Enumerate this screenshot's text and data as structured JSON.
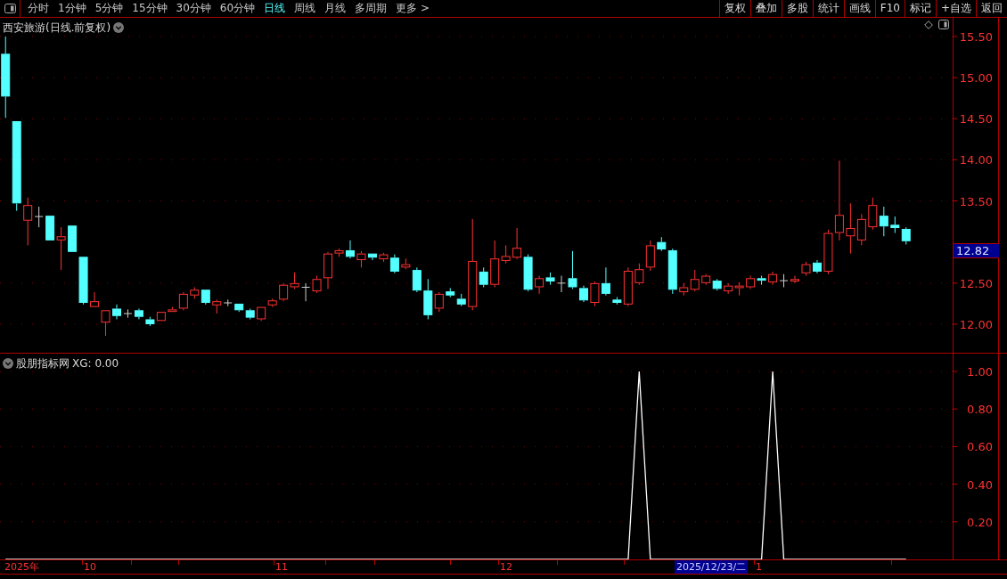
{
  "toolbar": {
    "periods": [
      {
        "label": "分时",
        "selected": false
      },
      {
        "label": "1分钟",
        "selected": false
      },
      {
        "label": "5分钟",
        "selected": false
      },
      {
        "label": "15分钟",
        "selected": false
      },
      {
        "label": "30分钟",
        "selected": false
      },
      {
        "label": "60分钟",
        "selected": false
      },
      {
        "label": "日线",
        "selected": true
      },
      {
        "label": "周线",
        "selected": false
      },
      {
        "label": "月线",
        "selected": false
      },
      {
        "label": "多周期",
        "selected": false
      },
      {
        "label": "更多 >",
        "selected": false
      }
    ],
    "buttons": [
      "复权",
      "叠加",
      "多股",
      "统计",
      "画线",
      "F10",
      "标记",
      "+自选",
      "返回"
    ]
  },
  "price_panel": {
    "title": "西安旅游(日线.前复权)",
    "current_price": "12.82",
    "chart_data": {
      "type": "candlestick",
      "grid": true,
      "ylim": [
        12.0,
        15.5
      ],
      "categories": [
        null,
        null,
        null,
        null,
        null,
        null,
        null,
        null,
        null,
        null,
        null,
        null,
        null,
        null,
        null,
        null,
        null,
        null,
        null,
        null,
        null,
        null,
        null,
        null,
        null,
        null,
        null,
        null,
        null,
        null,
        null,
        null,
        null,
        null,
        null,
        null,
        null,
        null,
        null,
        null,
        null,
        null,
        null,
        null,
        null,
        null,
        null,
        null,
        null,
        null,
        null,
        null,
        null,
        null,
        null,
        null,
        null,
        null,
        null,
        null,
        null,
        null,
        null,
        null,
        null,
        null,
        null,
        null,
        null,
        null,
        null,
        null,
        null,
        null,
        null,
        null,
        null,
        null,
        null,
        null,
        null,
        null
      ],
      "yticks": [
        {
          "value": 15.5,
          "label": "15.50"
        },
        {
          "value": 15.0,
          "label": "15.00"
        },
        {
          "value": 14.5,
          "label": "14.50"
        },
        {
          "value": 14.0,
          "label": "14.00"
        },
        {
          "value": 13.5,
          "label": "13.50"
        },
        {
          "value": 12.5,
          "label": "12.50"
        },
        {
          "value": 12.0,
          "label": "12.00"
        }
      ],
      "ohlc": [
        [
          15.29,
          15.5,
          14.51,
          14.77
        ],
        [
          14.47,
          14.47,
          13.38,
          13.47
        ],
        [
          13.26,
          13.54,
          12.96,
          13.45
        ],
        [
          13.31,
          13.43,
          13.18,
          13.31
        ],
        [
          13.32,
          13.32,
          13.02,
          13.02
        ],
        [
          13.02,
          13.18,
          12.66,
          13.07
        ],
        [
          13.2,
          13.2,
          12.88,
          12.88
        ],
        [
          12.82,
          12.82,
          12.24,
          12.26
        ],
        [
          12.21,
          12.39,
          12.21,
          12.28
        ],
        [
          12.02,
          12.17,
          11.86,
          12.17
        ],
        [
          12.19,
          12.24,
          12.06,
          12.1
        ],
        [
          12.13,
          12.18,
          12.08,
          12.13
        ],
        [
          12.17,
          12.19,
          12.06,
          12.09
        ],
        [
          12.06,
          12.09,
          11.98,
          12.0
        ],
        [
          12.04,
          12.16,
          12.03,
          12.15
        ],
        [
          12.15,
          12.21,
          12.14,
          12.18
        ],
        [
          12.19,
          12.39,
          12.17,
          12.37
        ],
        [
          12.35,
          12.45,
          12.31,
          12.42
        ],
        [
          12.42,
          12.42,
          12.24,
          12.26
        ],
        [
          12.23,
          12.3,
          12.13,
          12.28
        ],
        [
          12.26,
          12.3,
          12.22,
          12.26
        ],
        [
          12.25,
          12.26,
          12.15,
          12.17
        ],
        [
          12.17,
          12.19,
          12.06,
          12.08
        ],
        [
          12.06,
          12.22,
          12.04,
          12.21
        ],
        [
          12.23,
          12.31,
          12.21,
          12.29
        ],
        [
          12.3,
          12.5,
          12.28,
          12.48
        ],
        [
          12.45,
          12.63,
          12.43,
          12.5
        ],
        [
          12.45,
          12.5,
          12.28,
          12.45
        ],
        [
          12.4,
          12.59,
          12.38,
          12.55
        ],
        [
          12.56,
          12.88,
          12.43,
          12.86
        ],
        [
          12.86,
          12.92,
          12.82,
          12.9
        ],
        [
          12.9,
          13.02,
          12.8,
          12.82
        ],
        [
          12.78,
          12.89,
          12.69,
          12.86
        ],
        [
          12.86,
          12.87,
          12.78,
          12.81
        ],
        [
          12.79,
          12.87,
          12.76,
          12.85
        ],
        [
          12.81,
          12.85,
          12.62,
          12.64
        ],
        [
          12.69,
          12.8,
          12.67,
          12.73
        ],
        [
          12.66,
          12.69,
          12.39,
          12.41
        ],
        [
          12.41,
          12.55,
          12.06,
          12.11
        ],
        [
          12.19,
          12.39,
          12.15,
          12.37
        ],
        [
          12.4,
          12.44,
          12.33,
          12.35
        ],
        [
          12.31,
          12.37,
          12.22,
          12.24
        ],
        [
          12.21,
          13.28,
          12.17,
          12.77
        ],
        [
          12.64,
          12.69,
          12.45,
          12.48
        ],
        [
          12.48,
          13.02,
          12.45,
          12.8
        ],
        [
          12.77,
          12.96,
          12.74,
          12.83
        ],
        [
          12.81,
          13.17,
          12.79,
          12.93
        ],
        [
          12.82,
          12.85,
          12.4,
          12.42
        ],
        [
          12.45,
          12.59,
          12.37,
          12.56
        ],
        [
          12.57,
          12.63,
          12.48,
          12.52
        ],
        [
          12.5,
          12.59,
          12.39,
          12.5
        ],
        [
          12.56,
          12.89,
          12.43,
          12.45
        ],
        [
          12.44,
          12.47,
          12.27,
          12.29
        ],
        [
          12.26,
          12.52,
          12.22,
          12.5
        ],
        [
          12.5,
          12.69,
          12.35,
          12.37
        ],
        [
          12.3,
          12.33,
          12.24,
          12.26
        ],
        [
          12.24,
          12.69,
          12.22,
          12.65
        ],
        [
          12.5,
          12.74,
          12.48,
          12.67
        ],
        [
          12.69,
          13.02,
          12.65,
          12.96
        ],
        [
          13.0,
          13.06,
          12.89,
          12.91
        ],
        [
          12.9,
          12.92,
          12.37,
          12.42
        ],
        [
          12.39,
          12.5,
          12.35,
          12.45
        ],
        [
          12.42,
          12.66,
          12.4,
          12.55
        ],
        [
          12.5,
          12.61,
          12.48,
          12.59
        ],
        [
          12.53,
          12.55,
          12.41,
          12.43
        ],
        [
          12.4,
          12.5,
          12.37,
          12.47
        ],
        [
          12.44,
          12.51,
          12.35,
          12.47
        ],
        [
          12.45,
          12.59,
          12.43,
          12.56
        ],
        [
          12.56,
          12.59,
          12.48,
          12.53
        ],
        [
          12.51,
          12.64,
          12.48,
          12.61
        ],
        [
          12.53,
          12.61,
          12.45,
          12.53
        ],
        [
          12.52,
          12.59,
          12.5,
          12.55
        ],
        [
          12.62,
          12.76,
          12.59,
          12.73
        ],
        [
          12.75,
          12.78,
          12.62,
          12.64
        ],
        [
          12.64,
          13.15,
          12.61,
          13.11
        ],
        [
          13.11,
          13.99,
          13.02,
          13.33
        ],
        [
          13.07,
          13.47,
          12.86,
          13.17
        ],
        [
          13.02,
          13.34,
          12.96,
          13.28
        ],
        [
          13.18,
          13.54,
          13.15,
          13.45
        ],
        [
          13.32,
          13.43,
          13.07,
          13.19
        ],
        [
          13.21,
          13.31,
          13.11,
          13.17
        ],
        [
          13.16,
          13.18,
          12.97,
          13.01
        ]
      ]
    }
  },
  "indicator_panel": {
    "name": "股朋指标网",
    "reading": ": 0.00",
    "chart_data": {
      "type": "line",
      "grid": true,
      "ylim": [
        0,
        1.0
      ],
      "categories": [
        null,
        null,
        null,
        null,
        null,
        null,
        null,
        null,
        null,
        null,
        null,
        null,
        null,
        null,
        null,
        null,
        null,
        null,
        null,
        null,
        null,
        null,
        null,
        null,
        null,
        null,
        null,
        null,
        null,
        null,
        null,
        null,
        null,
        null,
        null,
        null,
        null,
        null,
        null,
        null,
        null,
        null,
        null,
        null,
        null,
        null,
        null,
        null,
        null,
        null,
        null,
        null,
        null,
        null,
        null,
        null,
        null,
        null,
        null,
        null,
        null,
        null,
        null,
        null,
        null,
        null,
        null,
        null,
        null,
        null,
        null,
        null,
        null,
        null,
        null,
        null,
        null,
        null,
        null,
        null,
        null,
        null
      ],
      "yticks": [
        {
          "value": 0.2,
          "label": "0.20"
        },
        {
          "value": 0.4,
          "label": "0.40"
        },
        {
          "value": 0.6,
          "label": "0.60"
        },
        {
          "value": 0.8,
          "label": "0.80"
        },
        {
          "value": 1.0,
          "label": "1.00"
        }
      ],
      "series": [
        {
          "name": "XG",
          "color": "#ffffff",
          "values": [
            0,
            0,
            0,
            0,
            0,
            0,
            0,
            0,
            0,
            0,
            0,
            0,
            0,
            0,
            0,
            0,
            0,
            0,
            0,
            0,
            0,
            0,
            0,
            0,
            0,
            0,
            0,
            0,
            0,
            0,
            0,
            0,
            0,
            0,
            0,
            0,
            0,
            0,
            0,
            0,
            0,
            0,
            0,
            0,
            0,
            0,
            0,
            0,
            0,
            0,
            0,
            0,
            0,
            0,
            0,
            0,
            0,
            1,
            0,
            0,
            0,
            0,
            0,
            0,
            0,
            0,
            0,
            0,
            0,
            1,
            0,
            0,
            0,
            0,
            0,
            0,
            0,
            0,
            0,
            0,
            0,
            0
          ]
        }
      ]
    }
  },
  "date_axis": [
    {
      "label": "2025年",
      "selected": false
    },
    {
      "label": "10",
      "selected": false
    },
    {
      "label": "11",
      "selected": false
    },
    {
      "label": "12",
      "selected": false
    },
    {
      "label": "2025/12/23/二",
      "selected": true
    },
    {
      "label": "1",
      "selected": false
    }
  ]
}
